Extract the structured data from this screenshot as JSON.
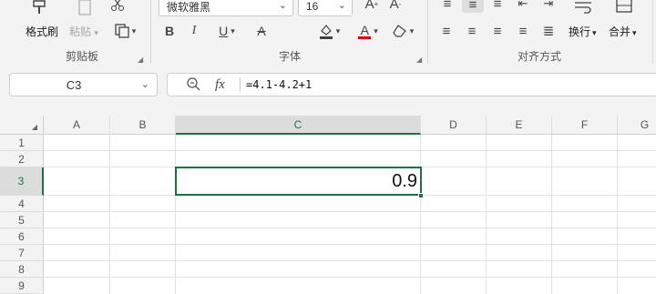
{
  "ribbon": {
    "clipboard": {
      "format_painter": "格式刷",
      "paste": "粘贴",
      "group_label": "剪贴板"
    },
    "font": {
      "font_name": "微软雅黑",
      "font_size": "16",
      "bold": "B",
      "italic": "I",
      "underline": "U",
      "strikethrough": "A",
      "font_color": "A",
      "font_color_value": "#e00000",
      "group_label": "字体"
    },
    "alignment": {
      "wrap_text": "换行",
      "merge": "合并",
      "group_label": "对齐方式"
    }
  },
  "namebox": {
    "value": "C3"
  },
  "formula": {
    "fx_label": "fx",
    "value": "=4.1-4.2+1"
  },
  "sheet": {
    "columns": [
      "A",
      "B",
      "C",
      "D",
      "E",
      "F",
      "G"
    ],
    "rows": [
      "1",
      "2",
      "3",
      "4",
      "5",
      "6",
      "7",
      "8",
      "9"
    ],
    "active_cell_value": "0.9"
  },
  "colors": {
    "accent": "#1e7145"
  }
}
